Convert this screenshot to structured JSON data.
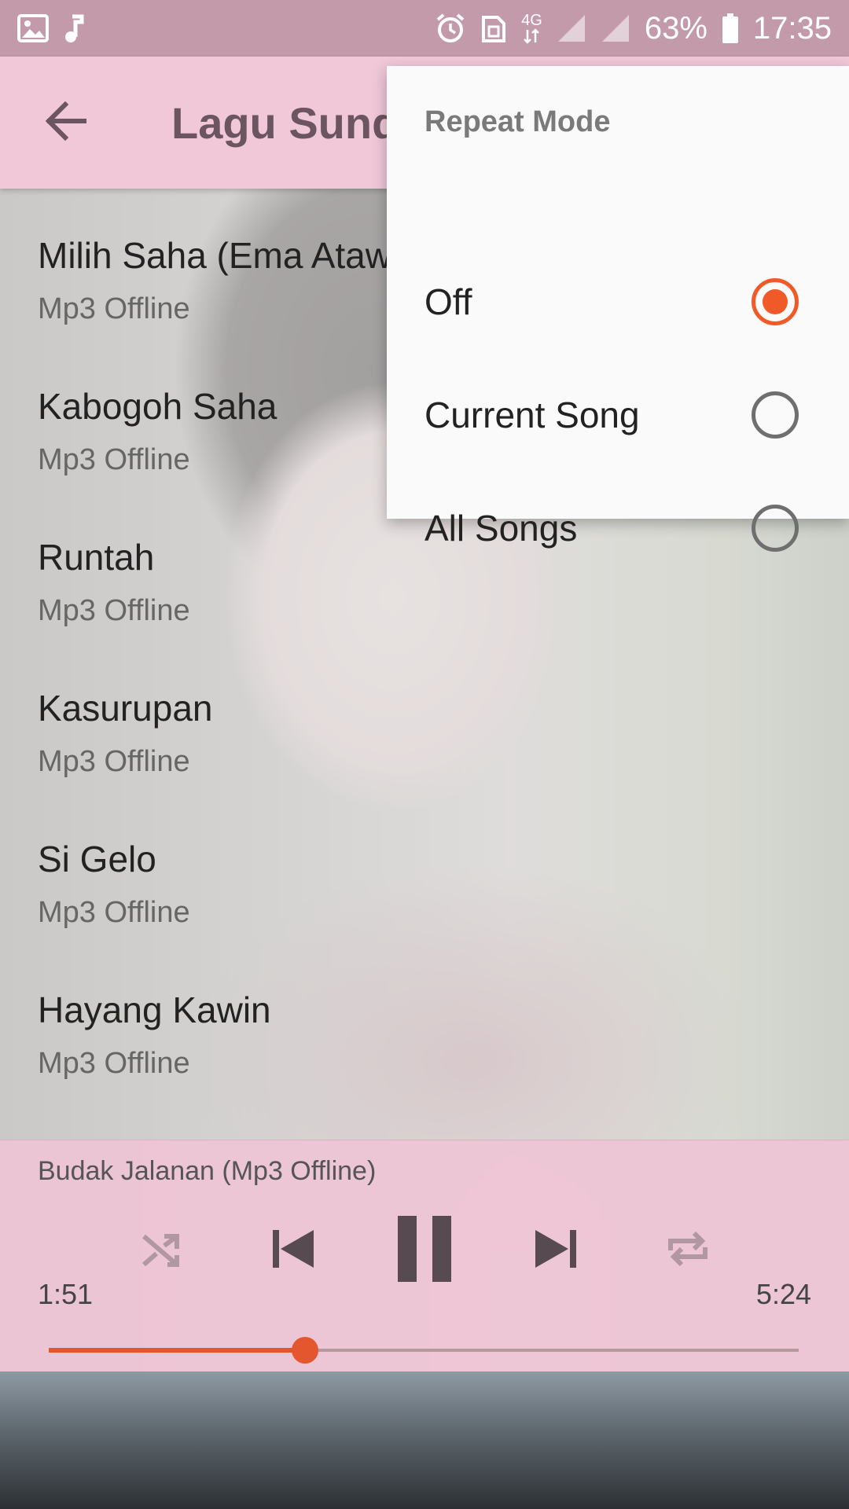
{
  "status_bar": {
    "battery": "63%",
    "time": "17:35",
    "network": "4G",
    "icons_left": [
      "image-icon",
      "music-note-icon"
    ],
    "icons_right": [
      "alarm-icon",
      "nfc-icon",
      "data-arrows-icon",
      "signal-icon",
      "signal-icon",
      "battery-icon"
    ]
  },
  "app_bar": {
    "title": "Lagu Sunda",
    "back_icon": "arrow-back-icon"
  },
  "songs": [
    {
      "title": "Milih Saha (Ema Atawa",
      "subtitle": "Mp3 Offline"
    },
    {
      "title": "Kabogoh Saha",
      "subtitle": "Mp3 Offline"
    },
    {
      "title": "Runtah",
      "subtitle": "Mp3 Offline"
    },
    {
      "title": "Kasurupan",
      "subtitle": "Mp3 Offline"
    },
    {
      "title": "Si Gelo",
      "subtitle": "Mp3 Offline"
    },
    {
      "title": "Hayang Kawin",
      "subtitle": "Mp3 Offline"
    }
  ],
  "player": {
    "now_playing": "Budak Jalanan (Mp3 Offline)",
    "current_time": "1:51",
    "total_time": "5:24",
    "progress": 0.342,
    "accent": "#e4572e",
    "controls": [
      "shuffle-icon",
      "previous-icon",
      "pause-icon",
      "next-icon",
      "repeat-icon"
    ]
  },
  "repeat_popup": {
    "title": "Repeat Mode",
    "options": [
      {
        "label": "Off",
        "checked": true
      },
      {
        "label": "Current Song",
        "checked": false
      },
      {
        "label": "All Songs",
        "checked": false
      }
    ],
    "accent": "#f05a28"
  }
}
